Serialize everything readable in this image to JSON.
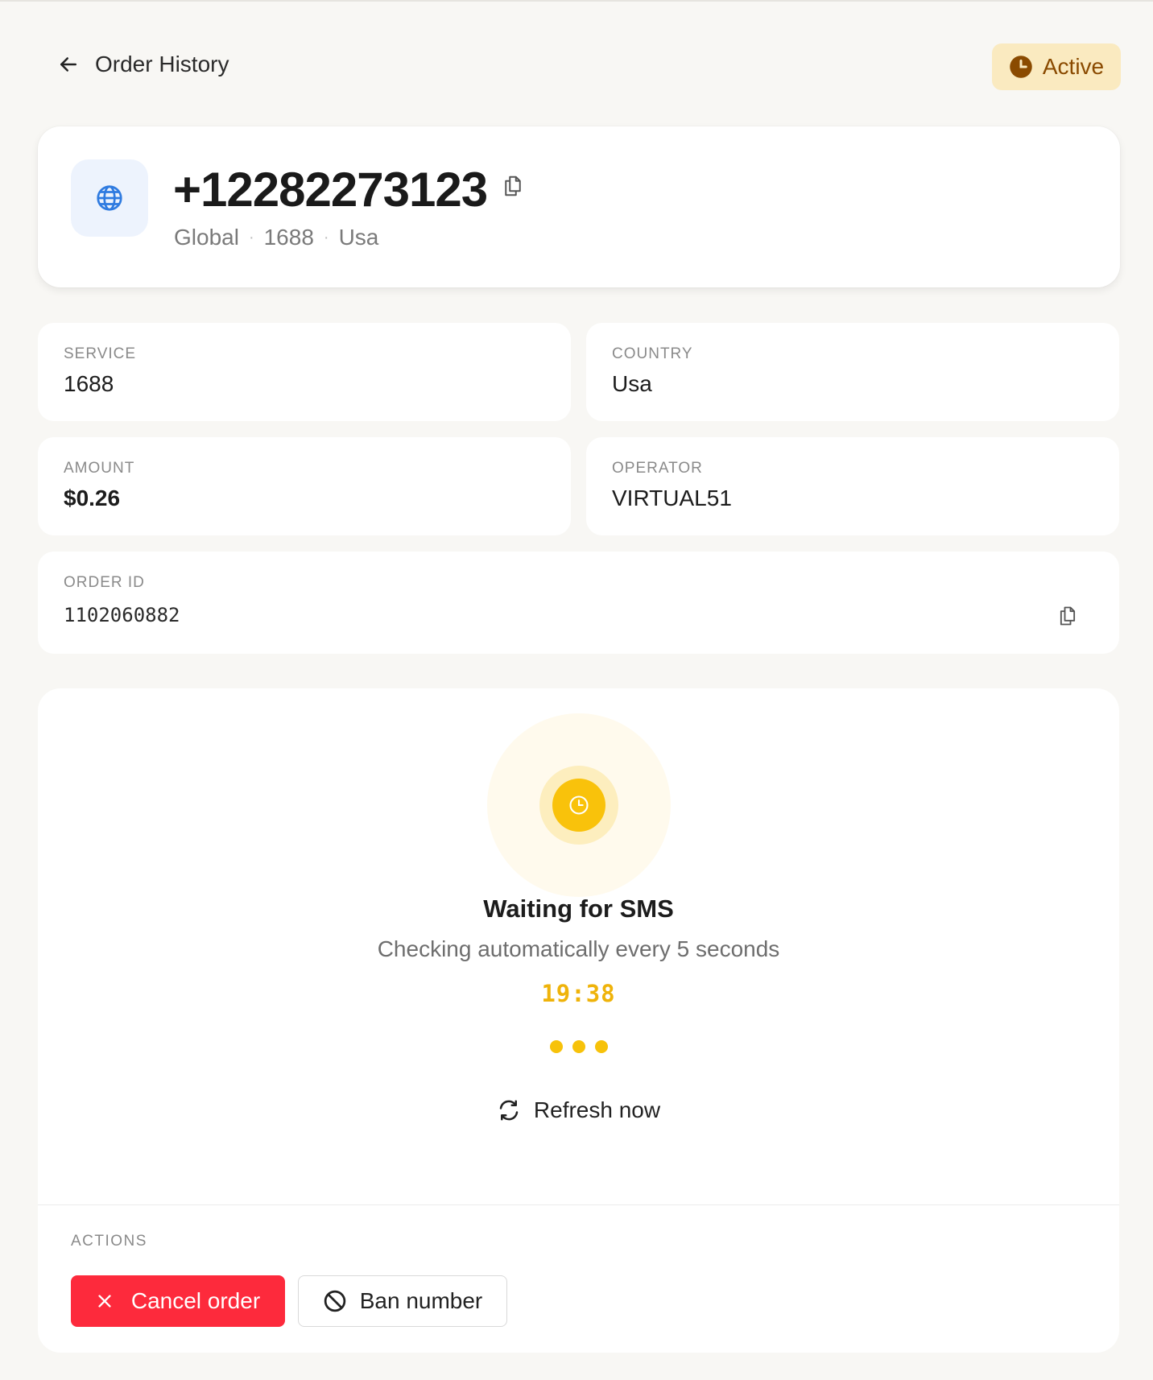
{
  "header": {
    "back_icon": "arrow-left-icon",
    "title": "Order History",
    "status": "Active",
    "status_icon": "clock-icon",
    "status_color": "#8a4a00",
    "status_bg": "#faeac0"
  },
  "phone": {
    "icon": "globe-icon",
    "number": "+12282273123",
    "copy_icon": "copy-icon",
    "meta": [
      "Global",
      "1688",
      "Usa"
    ],
    "meta_separator": "·"
  },
  "details": {
    "service": {
      "label": "SERVICE",
      "value": "1688"
    },
    "country": {
      "label": "COUNTRY",
      "value": "Usa"
    },
    "amount": {
      "label": "AMOUNT",
      "value": "$0.26"
    },
    "operator": {
      "label": "OPERATOR",
      "value": "VIRTUAL51"
    },
    "order_id": {
      "label": "ORDER ID",
      "value": "1102060882"
    }
  },
  "waiting": {
    "icon": "clock-icon",
    "title": "Waiting for SMS",
    "subtitle": "Checking automatically every 5 seconds",
    "timer": "19:38",
    "accent": "#f9c20b",
    "refresh_label": "Refresh now",
    "refresh_icon": "refresh-icon"
  },
  "actions": {
    "label": "ACTIONS",
    "cancel_label": "Cancel order",
    "cancel_icon": "x-icon",
    "cancel_color": "#fd2a3c",
    "ban_label": "Ban number",
    "ban_icon": "ban-icon"
  }
}
